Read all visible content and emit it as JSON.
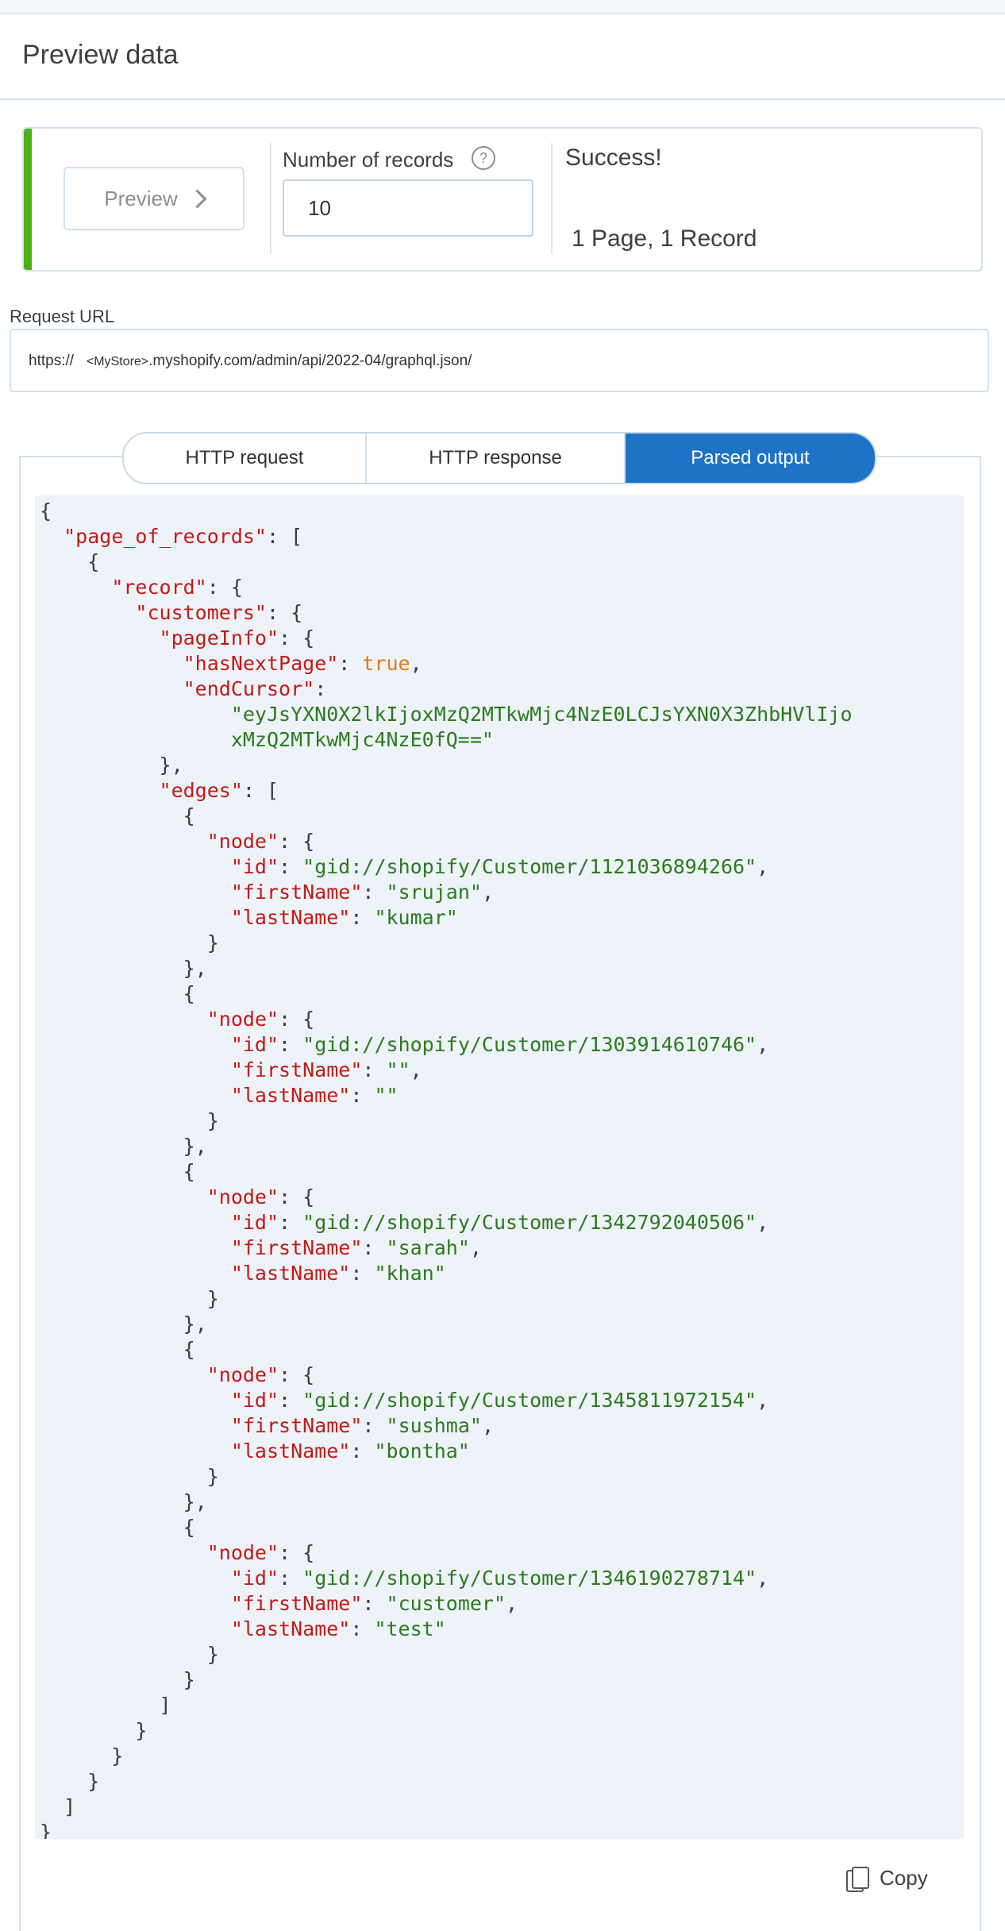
{
  "header": {
    "title": "Preview data"
  },
  "preview": {
    "button_label": "Preview",
    "records_label": "Number of records",
    "records_value": "10",
    "status": "Success!",
    "summary": "1 Page, 1 Record",
    "status_color": "#4caf16"
  },
  "request": {
    "label": "Request URL",
    "url_prefix": "https://",
    "url_store": "<MyStore>",
    "url_suffix": ".myshopify.com/admin/api/2022-04/graphql.json/"
  },
  "tabs": [
    {
      "label": "HTTP request",
      "active": false
    },
    {
      "label": "HTTP response",
      "active": false
    },
    {
      "label": "Parsed output",
      "active": true
    }
  ],
  "output": {
    "page_of_records": [
      {
        "record": {
          "customers": {
            "pageInfo": {
              "hasNextPage": true,
              "endCursor": "eyJsYXN0X2lkIjoxMzQ2MTkwMjc4NzE0LCJsYXN0X3ZhbHVlIjoxMzQ2MTkwMjc4NzE0fQ=="
            },
            "edges": [
              {
                "node": {
                  "id": "gid://shopify/Customer/1121036894266",
                  "firstName": "srujan",
                  "lastName": "kumar"
                }
              },
              {
                "node": {
                  "id": "gid://shopify/Customer/1303914610746",
                  "firstName": "",
                  "lastName": ""
                }
              },
              {
                "node": {
                  "id": "gid://shopify/Customer/1342792040506",
                  "firstName": "sarah",
                  "lastName": "khan"
                }
              },
              {
                "node": {
                  "id": "gid://shopify/Customer/1345811972154",
                  "firstName": "sushma",
                  "lastName": "bontha"
                }
              },
              {
                "node": {
                  "id": "gid://shopify/Customer/1346190278714",
                  "firstName": "customer",
                  "lastName": "test"
                }
              }
            ]
          }
        }
      }
    ]
  },
  "copy": {
    "label": "Copy",
    "icon": "copy-icon"
  },
  "colors": {
    "accent": "#1f73c7",
    "json_key": "#c41a16",
    "json_string": "#2d7a1e",
    "json_bool": "#e07a14",
    "code_bg": "#edf3f9"
  }
}
